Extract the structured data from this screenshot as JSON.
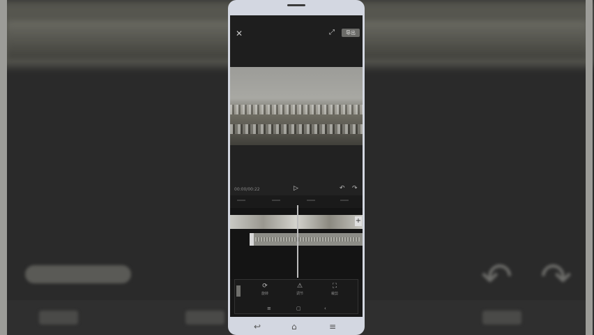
{
  "editor": {
    "close_icon": "close-icon",
    "fullscreen_icon": "fullscreen-icon",
    "export_label": "导出",
    "timecode": "00:00/00:22"
  },
  "tools": [
    {
      "icon": "rotate-icon",
      "glyph": "⟳",
      "label": "旋转"
    },
    {
      "icon": "warning-icon",
      "glyph": "⚠",
      "label": "调节"
    },
    {
      "icon": "crop-icon",
      "glyph": "⛶",
      "label": "裁剪"
    }
  ],
  "subnav": [
    {
      "icon": "menu-icon",
      "glyph": "≡"
    },
    {
      "icon": "square-icon",
      "glyph": "▢"
    },
    {
      "icon": "back-icon",
      "glyph": "‹"
    }
  ],
  "system_nav": [
    {
      "icon": "back-icon",
      "glyph": "↩"
    },
    {
      "icon": "home-icon",
      "glyph": "⌂"
    },
    {
      "icon": "menu-icon",
      "glyph": "≡"
    }
  ],
  "colors": {
    "phone_frame": "#d3d7e1",
    "screen_bg": "#161616"
  }
}
